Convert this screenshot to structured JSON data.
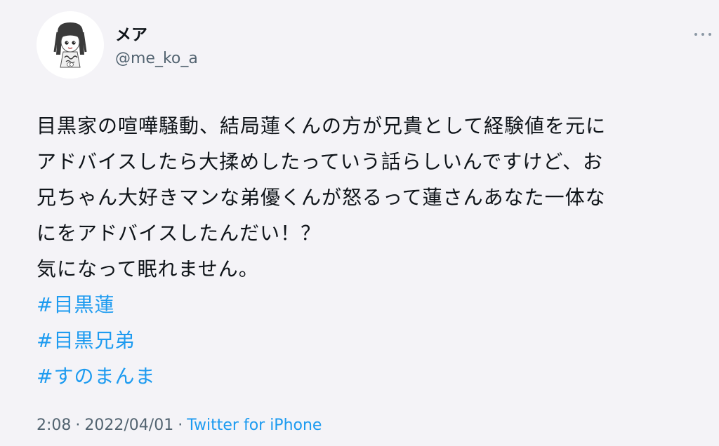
{
  "author": {
    "display_name": "メア",
    "handle": "@me_ko_a",
    "avatar_icon": "girl-illustration-avatar"
  },
  "more_icon": "more-dots-icon",
  "tweet": {
    "lines": [
      "目黒家の喧嘩騒動、結局蓮くんの方が兄貴として経験値を元に",
      "アドバイスしたら大揉めしたっていう話らしいんですけど、お",
      "兄ちゃん大好きマンな弟優くんが怒るって蓮さんあなた一体な",
      "にをアドバイスしたんだい！？",
      "気になって眠れません。"
    ],
    "hashtags": [
      "#目黒蓮",
      "#目黒兄弟",
      "#すのまんま"
    ]
  },
  "meta": {
    "time": "2:08",
    "date": "2022/04/01",
    "separator": "·",
    "source": "Twitter for iPhone"
  },
  "colors": {
    "background": "#f4f3f7",
    "text": "#0f1419",
    "secondary": "#536471",
    "link": "#1d9bf0"
  }
}
